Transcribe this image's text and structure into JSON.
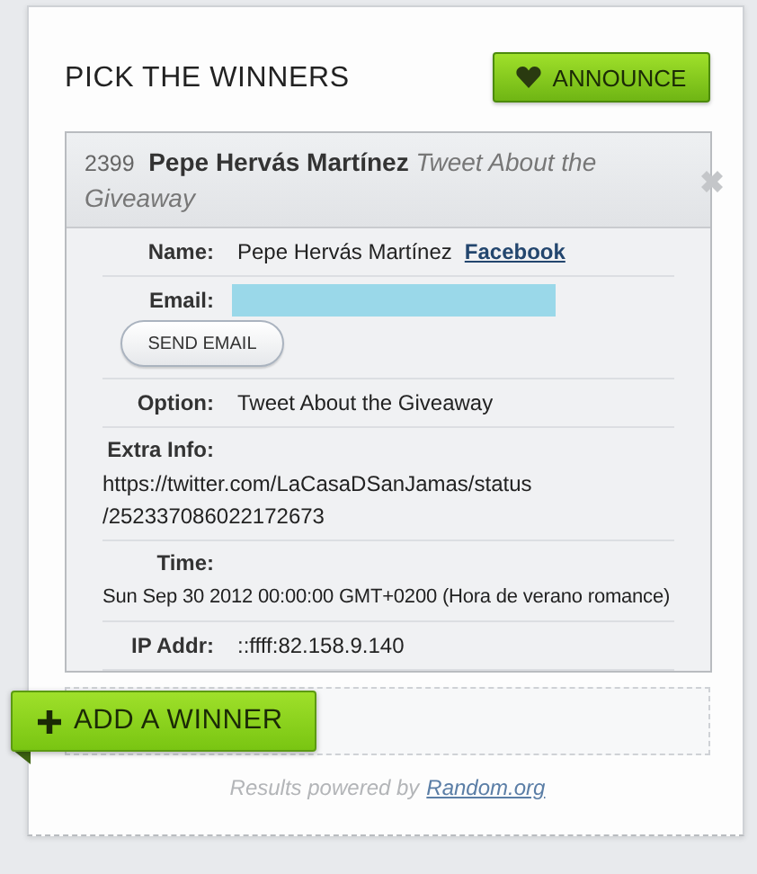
{
  "title": "PICK THE WINNERS",
  "announce_button": {
    "label": "ANNOUNCE"
  },
  "winner": {
    "number": "2399",
    "name": "Pepe Hervás Martínez",
    "option": "Tweet About the Giveaway",
    "fields": [
      {
        "kind": "name",
        "label": "Name:",
        "value": "Pepe Hervás Martínez",
        "link": "Facebook"
      },
      {
        "kind": "email",
        "label": "Email:",
        "button": "SEND EMAIL"
      },
      {
        "kind": "inline",
        "label": "Option:",
        "value": "Tweet About the Giveaway"
      },
      {
        "kind": "stacked",
        "label": "Extra Info:",
        "lines": [
          "https://twitter.com/LaCasaDSanJamas/status",
          "/252337086022172673"
        ]
      },
      {
        "kind": "stacked",
        "label": "Time:",
        "lines": [
          "Sun Sep 30 2012 00:00:00 GMT+0200 (Hora de verano romance)"
        ]
      },
      {
        "kind": "inline",
        "label": "IP Addr:",
        "value": "::ffff:82.158.9.140"
      }
    ]
  },
  "add_button": {
    "label": "ADD A WINNER"
  },
  "footer": {
    "text": "Results powered by",
    "link": "Random.org"
  }
}
